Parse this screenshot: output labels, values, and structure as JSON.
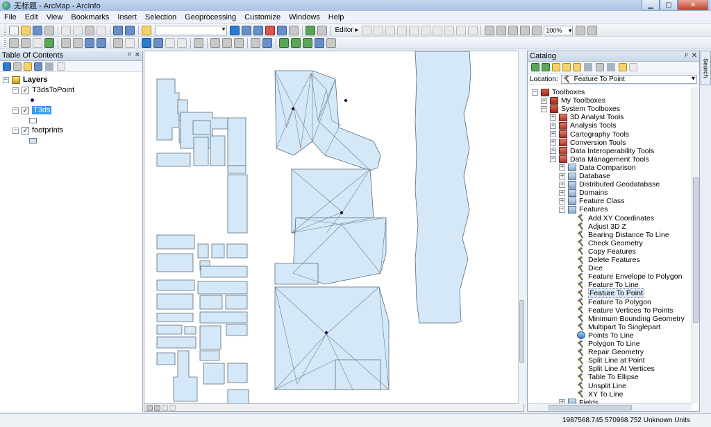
{
  "window": {
    "title": "无标题 - ArcMap - ArcInfo"
  },
  "menu": [
    "File",
    "Edit",
    "View",
    "Bookmarks",
    "Insert",
    "Selection",
    "Geoprocessing",
    "Customize",
    "Windows",
    "Help"
  ],
  "toolbar": {
    "editor_label": "Editor ▸",
    "zoom_value": "100%"
  },
  "toc": {
    "title": "Table Of Contents",
    "root": "Layers",
    "layers": [
      {
        "name": "T3dsToPoint",
        "checked": true,
        "symbol": "point"
      },
      {
        "name": "T3ds",
        "checked": true,
        "selected": true,
        "symbol": "hollow-polygon"
      },
      {
        "name": "footprints",
        "checked": true,
        "symbol": "blue-polygon"
      }
    ]
  },
  "catalog": {
    "title": "Catalog",
    "location_label": "Location:",
    "location_value": "Feature To Point",
    "tree": [
      {
        "label": "Toolboxes",
        "level": 0,
        "exp": "-",
        "icon": "toolbox"
      },
      {
        "label": "My Toolboxes",
        "level": 1,
        "exp": "+",
        "icon": "toolbox"
      },
      {
        "label": "System Toolboxes",
        "level": 1,
        "exp": "-",
        "icon": "toolbox"
      },
      {
        "label": "3D Analyst Tools",
        "level": 2,
        "exp": "+",
        "icon": "toolbox-sub"
      },
      {
        "label": "Analysis Tools",
        "level": 2,
        "exp": "+",
        "icon": "toolbox-sub"
      },
      {
        "label": "Cartography Tools",
        "level": 2,
        "exp": "+",
        "icon": "toolbox-sub"
      },
      {
        "label": "Conversion Tools",
        "level": 2,
        "exp": "+",
        "icon": "toolbox-sub"
      },
      {
        "label": "Data Interoperability Tools",
        "level": 2,
        "exp": "+",
        "icon": "toolbox-sub"
      },
      {
        "label": "Data Management Tools",
        "level": 2,
        "exp": "-",
        "icon": "toolbox-sub"
      },
      {
        "label": "Data Comparison",
        "level": 3,
        "exp": "+",
        "icon": "toolset"
      },
      {
        "label": "Database",
        "level": 3,
        "exp": "+",
        "icon": "toolset"
      },
      {
        "label": "Distributed Geodatabase",
        "level": 3,
        "exp": "+",
        "icon": "toolset"
      },
      {
        "label": "Domains",
        "level": 3,
        "exp": "+",
        "icon": "toolset"
      },
      {
        "label": "Feature Class",
        "level": 3,
        "exp": "+",
        "icon": "toolset"
      },
      {
        "label": "Features",
        "level": 3,
        "exp": "-",
        "icon": "toolset"
      },
      {
        "label": "Add XY Coordinates",
        "level": 4,
        "exp": "",
        "icon": "hammer"
      },
      {
        "label": "Adjust 3D Z",
        "level": 4,
        "exp": "",
        "icon": "hammer"
      },
      {
        "label": "Bearing Distance To Line",
        "level": 4,
        "exp": "",
        "icon": "hammer"
      },
      {
        "label": "Check Geometry",
        "level": 4,
        "exp": "",
        "icon": "hammer"
      },
      {
        "label": "Copy Features",
        "level": 4,
        "exp": "",
        "icon": "hammer"
      },
      {
        "label": "Delete Features",
        "level": 4,
        "exp": "",
        "icon": "hammer"
      },
      {
        "label": "Dice",
        "level": 4,
        "exp": "",
        "icon": "hammer"
      },
      {
        "label": "Feature Envelope to Polygon",
        "level": 4,
        "exp": "",
        "icon": "hammer"
      },
      {
        "label": "Feature To Line",
        "level": 4,
        "exp": "",
        "icon": "hammer"
      },
      {
        "label": "Feature To Point",
        "level": 4,
        "exp": "",
        "icon": "hammer",
        "selected": true
      },
      {
        "label": "Feature To Polygon",
        "level": 4,
        "exp": "",
        "icon": "hammer"
      },
      {
        "label": "Feature Vertices To Points",
        "level": 4,
        "exp": "",
        "icon": "hammer"
      },
      {
        "label": "Minimum Bounding Geometry",
        "level": 4,
        "exp": "",
        "icon": "hammer"
      },
      {
        "label": "Multipart To Singlepart",
        "level": 4,
        "exp": "",
        "icon": "hammer"
      },
      {
        "label": "Points To Line",
        "level": 4,
        "exp": "",
        "icon": "script"
      },
      {
        "label": "Polygon To Line",
        "level": 4,
        "exp": "",
        "icon": "hammer"
      },
      {
        "label": "Repair Geometry",
        "level": 4,
        "exp": "",
        "icon": "hammer"
      },
      {
        "label": "Split Line at Point",
        "level": 4,
        "exp": "",
        "icon": "hammer"
      },
      {
        "label": "Split Line At Vertices",
        "level": 4,
        "exp": "",
        "icon": "hammer"
      },
      {
        "label": "Table To Ellipse",
        "level": 4,
        "exp": "",
        "icon": "hammer"
      },
      {
        "label": "Unsplit Line",
        "level": 4,
        "exp": "",
        "icon": "hammer"
      },
      {
        "label": "XY To Line",
        "level": 4,
        "exp": "",
        "icon": "hammer"
      },
      {
        "label": "Fields",
        "level": 3,
        "exp": "+",
        "icon": "toolset"
      }
    ]
  },
  "search_tab": "Search",
  "status": {
    "coordinates": "1987568.745  570968.752 Unknown Units"
  },
  "colors": {
    "footprint_fill": "#d4e8f7",
    "footprint_stroke": "#5a6a7a",
    "point": "#141466",
    "selection": "#3399ff"
  }
}
